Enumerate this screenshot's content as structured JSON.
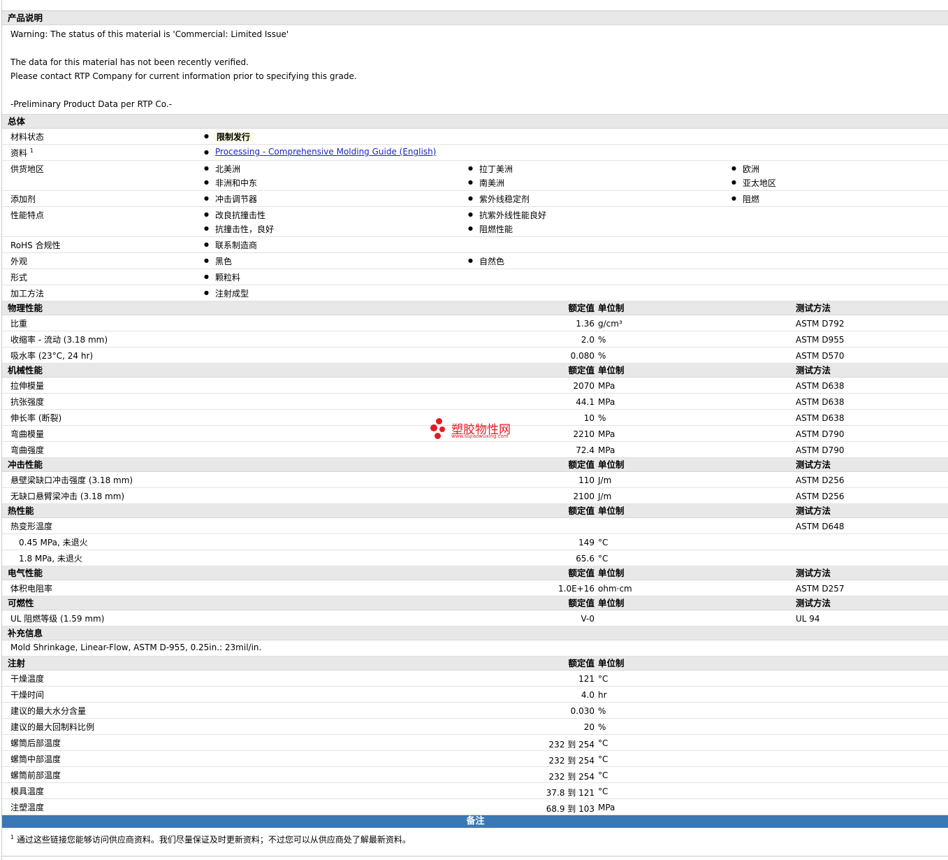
{
  "product": {
    "title": "产品说明",
    "lines": [
      "Warning: The status of this material is 'Commercial: Limited Issue'",
      "",
      "The data for this material has not been recently verified.",
      "Please contact RTP Company for current information prior to specifying this grade.",
      "",
      "-Preliminary Product Data per RTP Co.-"
    ]
  },
  "general": {
    "title": "总体",
    "material_status": {
      "label": "材料状态",
      "value": "限制发行"
    },
    "docs": {
      "label": "资料",
      "sup": "1",
      "link": "Processing - Comprehensive Molding Guide (English)"
    },
    "supply": {
      "label": "供货地区",
      "items": [
        "北美洲",
        "拉丁美洲",
        "欧洲",
        "非洲和中东",
        "南美洲",
        "亚太地区"
      ]
    },
    "additives": {
      "label": "添加剂",
      "items": [
        "冲击调节器",
        "紫外线稳定剂",
        "阻燃"
      ]
    },
    "features": {
      "label": "性能特点",
      "items": [
        "改良抗撞击性",
        "抗紫外线性能良好",
        "抗撞击性，良好",
        "阻燃性能"
      ]
    },
    "rohs": {
      "label": "RoHS 合规性",
      "items": [
        "联系制造商"
      ]
    },
    "appearance": {
      "label": "外观",
      "items": [
        "黑色",
        "自然色"
      ]
    },
    "form": {
      "label": "形式",
      "items": [
        "颗粒料"
      ]
    },
    "method": {
      "label": "加工方法",
      "items": [
        "注射成型"
      ]
    }
  },
  "headers": {
    "value": "额定值",
    "unit": "单位制",
    "test": "测试方法"
  },
  "physical": {
    "title": "物理性能",
    "rows": [
      {
        "label": "比重",
        "value": "1.36",
        "unit": "g/cm³",
        "test": "ASTM D792"
      },
      {
        "label": "收缩率 - 流动 (3.18 mm)",
        "value": "2.0",
        "unit": "%",
        "test": "ASTM D955"
      },
      {
        "label": "吸水率 (23°C, 24 hr)",
        "value": "0.080",
        "unit": "%",
        "test": "ASTM D570"
      }
    ]
  },
  "mechanical": {
    "title": "机械性能",
    "rows": [
      {
        "label": "拉伸模量",
        "value": "2070",
        "unit": "MPa",
        "test": "ASTM D638"
      },
      {
        "label": "抗张强度",
        "value": "44.1",
        "unit": "MPa",
        "test": "ASTM D638"
      },
      {
        "label": "伸长率 (断裂)",
        "value": "10",
        "unit": "%",
        "test": "ASTM D638"
      },
      {
        "label": "弯曲模量",
        "value": "2210",
        "unit": "MPa",
        "test": "ASTM D790"
      },
      {
        "label": "弯曲强度",
        "value": "72.4",
        "unit": "MPa",
        "test": "ASTM D790"
      }
    ]
  },
  "impact": {
    "title": "冲击性能",
    "rows": [
      {
        "label": "悬壁梁缺口冲击强度 (3.18 mm)",
        "value": "110",
        "unit": "J/m",
        "test": "ASTM D256"
      },
      {
        "label": "无缺口悬臂梁冲击 (3.18 mm)",
        "value": "2100",
        "unit": "J/m",
        "test": "ASTM D256"
      }
    ]
  },
  "thermal": {
    "title": "热性能",
    "rows": [
      {
        "label": "热变形温度",
        "value": "",
        "unit": "",
        "test": "ASTM D648"
      },
      {
        "label": "0.45 MPa, 未退火",
        "value": "149",
        "unit": "°C",
        "test": ""
      },
      {
        "label": "1.8 MPa, 未退火",
        "value": "65.6",
        "unit": "°C",
        "test": ""
      }
    ]
  },
  "electrical": {
    "title": "电气性能",
    "rows": [
      {
        "label": "体积电阻率",
        "value": "1.0E+16",
        "unit": "ohm·cm",
        "test": "ASTM D257"
      }
    ]
  },
  "flammability": {
    "title": "可燃性",
    "rows": [
      {
        "label": "UL 阻燃等级 (1.59 mm)",
        "value": "V-0",
        "unit": "",
        "test": "UL 94"
      }
    ]
  },
  "supplement": {
    "title": "补充信息",
    "text": "Mold Shrinkage, Linear-Flow, ASTM D-955, 0.25in.: 23mil/in."
  },
  "injection": {
    "title": "注射",
    "rows": [
      {
        "label": "干燥温度",
        "value": "121",
        "unit": "°C"
      },
      {
        "label": "干燥时间",
        "value": "4.0",
        "unit": "hr"
      },
      {
        "label": "建议的最大水分含量",
        "value": "0.030",
        "unit": "%"
      },
      {
        "label": "建议的最大回制料比例",
        "value": "20",
        "unit": "%"
      },
      {
        "label": "螺筒后部温度",
        "value": "232 到  254",
        "unit": "°C"
      },
      {
        "label": "螺筒中部温度",
        "value": "232 到  254",
        "unit": "°C"
      },
      {
        "label": "螺筒前部温度",
        "value": "232 到  254",
        "unit": "°C"
      },
      {
        "label": "模具温度",
        "value": "37.8 到  121",
        "unit": "°C"
      },
      {
        "label": "注塑温度",
        "value": "68.9 到  103",
        "unit": "MPa"
      }
    ]
  },
  "notes": {
    "title": "备注",
    "sup": "1",
    "text": "通过这些链接您能够访问供应商资料。我们尽量保证及时更新资料；不过您可以从供应商处了解最新资料。"
  },
  "watermark": {
    "title": "塑胶物性网",
    "url": "www.sujiaowuxing.com",
    "color": "#e21b23"
  },
  "colors": {
    "section_bg": "#e8e8e8",
    "note_bar": "#3a78b5",
    "link": "#1a23c9"
  }
}
